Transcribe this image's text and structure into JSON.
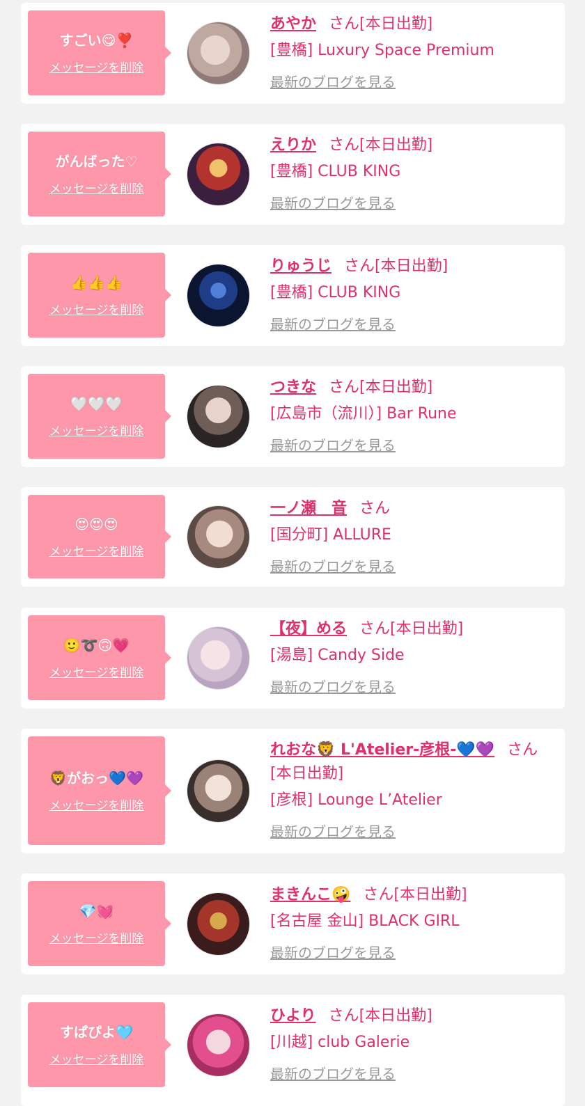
{
  "colors": {
    "accent": "#e0306a",
    "bubble": "#ff97ab",
    "muted": "#999999",
    "background": "#f2f2f2"
  },
  "delete_label": "メッセージを削除",
  "blog_label": "最新のブログを見る",
  "honorific": "さん",
  "attendance_label": "[本日出勤]",
  "entries": [
    {
      "message": "すごい😋❣️",
      "name": "あやか",
      "attendance": "[本日出勤]",
      "shop": "[豊橋] Luxury Space Premium"
    },
    {
      "message": "がんばった♡",
      "name": "えりか",
      "attendance": "[本日出勤]",
      "shop": "[豊橋] CLUB KING"
    },
    {
      "message": "👍👍👍",
      "name": "りゅうじ",
      "attendance": "[本日出勤]",
      "shop": "[豊橋] CLUB KING"
    },
    {
      "message": "🤍🤍🤍",
      "name": "つきな",
      "attendance": "[本日出勤]",
      "shop": "[広島市（流川）] Bar Rune"
    },
    {
      "message": "😍😍😍",
      "name": "一ノ瀬　音",
      "attendance": "",
      "shop": "[国分町] ALLURE"
    },
    {
      "message": "🙂➰🙃💗",
      "name": "【夜】める",
      "attendance": "[本日出勤]",
      "shop": "[湯島] Candy Side"
    },
    {
      "message": "🦁がおっ💙💜",
      "name": "れおな🦁 L'Atelier-彦根-💙💜",
      "attendance": "[本日出勤]",
      "shop": "[彦根] Lounge L’Atelier"
    },
    {
      "message": "💎💓",
      "name": "まきんこ🤪",
      "attendance": "[本日出勤]",
      "shop": "[名古屋 金山] BLACK GIRL"
    },
    {
      "message": "すぱぴよ🩵",
      "name": "ひより",
      "attendance": "[本日出勤]",
      "shop": "[川越] club Galerie"
    }
  ]
}
